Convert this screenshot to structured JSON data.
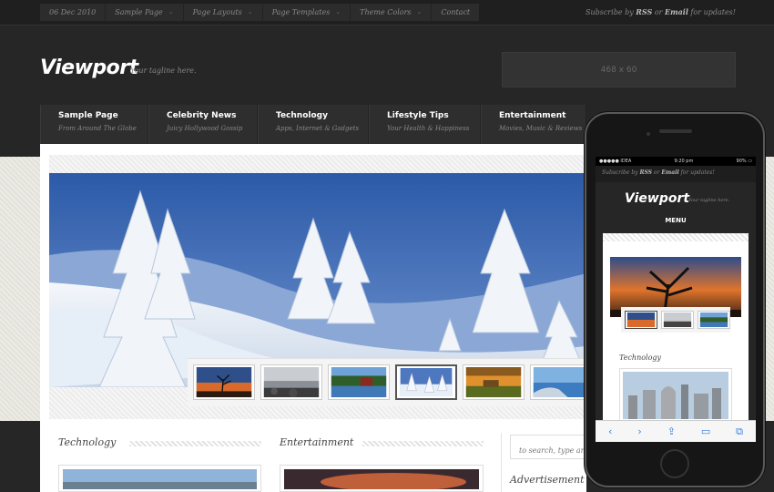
{
  "topbar": {
    "date": "06 Dec 2010",
    "nav": [
      {
        "label": "Sample Page",
        "dropdown": true
      },
      {
        "label": "Page Layouts",
        "dropdown": true
      },
      {
        "label": "Page Templates",
        "dropdown": true
      },
      {
        "label": "Theme Colors",
        "dropdown": true
      },
      {
        "label": "Contact",
        "dropdown": false
      }
    ],
    "subscribe": {
      "pre": "Subscribe by ",
      "rss": "RSS",
      "mid": " or ",
      "email": "Email",
      "post": " for updates!"
    }
  },
  "header": {
    "logo": "Viewport",
    "tagline": "Your tagline here.",
    "ad": "468 x 60"
  },
  "main_nav": [
    {
      "title": "Sample Page",
      "sub": "From Around The Globe"
    },
    {
      "title": "Celebrity News",
      "sub": "Juicy Hollywood Gossip"
    },
    {
      "title": "Technology",
      "sub": "Apps, Internet & Gadgets"
    },
    {
      "title": "Lifestyle Tips",
      "sub": "Your Health & Happiness"
    },
    {
      "title": "Entertainment",
      "sub": "Movies, Music & Reviews"
    }
  ],
  "slider": {
    "active_thumb": 3,
    "thumbs": [
      "sunset-tree",
      "rocky-shore",
      "lake-boathouse",
      "snow-trees",
      "sunset-field",
      "coast-rocks"
    ]
  },
  "sections": {
    "left": "Technology",
    "right": "Entertainment",
    "search_placeholder": "to search, type and",
    "sidebar_title": "Advertisement"
  },
  "phone": {
    "status": {
      "carrier": "IDEA",
      "time": "9:20 pm",
      "battery": "90%"
    },
    "subscribe": {
      "pre": "Subscribe by ",
      "rss": "RSS",
      "mid": " or ",
      "email": "Email",
      "post": " for updates!"
    },
    "logo": "Viewport",
    "tagline": "Your tagline here.",
    "menu": "MENU",
    "section": "Technology",
    "toolbar_icons": [
      "back-arrow",
      "forward-arrow",
      "share",
      "bookmarks",
      "tabs"
    ]
  },
  "colors": {
    "page_bg": "#262626",
    "content_bg": "#ffffff",
    "ios_blue": "#3a7ee0"
  }
}
